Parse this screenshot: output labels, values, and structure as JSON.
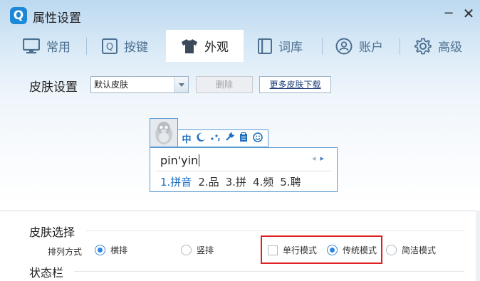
{
  "window": {
    "title": "属性设置",
    "logo_glyph": "Q",
    "minimize_glyph": "−",
    "close_glyph": "✕"
  },
  "tabs": [
    {
      "label": "常用",
      "icon": "monitor-icon",
      "active": false
    },
    {
      "label": "按键",
      "icon": "key-icon",
      "active": false
    },
    {
      "label": "外观",
      "icon": "tshirt-icon",
      "active": true
    },
    {
      "label": "词库",
      "icon": "book-icon",
      "active": false
    },
    {
      "label": "账户",
      "icon": "user-icon",
      "active": false
    },
    {
      "label": "高级",
      "icon": "gear-icon",
      "active": false
    }
  ],
  "skin": {
    "label": "皮肤设置",
    "selected": "默认皮肤",
    "delete_label": "删除",
    "more_label": "更多皮肤下载"
  },
  "ime_preview": {
    "toolbar_icons": [
      "中",
      "moon-icon",
      "punctuation-icon",
      "wrench-icon",
      "clipboard-icon",
      "smile-icon"
    ],
    "toolbar_chinese_glyph": "中",
    "input": "pin'yin",
    "candidates": [
      "1.拼音",
      "2.品",
      "3.拼",
      "4.频",
      "5.聘"
    ]
  },
  "skin_choice": {
    "title": "皮肤选择",
    "layout_label": "排列方式",
    "horizontal_label": "横排",
    "vertical_label": "竖排",
    "single_line_label": "单行模式",
    "traditional_label": "传统模式",
    "simple_label": "简洁模式",
    "layout_selected": "横排",
    "mode_selected": "传统模式",
    "single_line_checked": false
  },
  "status_bar": {
    "title": "状态栏"
  },
  "colors": {
    "accent": "#2f86e0",
    "highlight": "#e02020",
    "tab_text": "#4d6f90"
  }
}
